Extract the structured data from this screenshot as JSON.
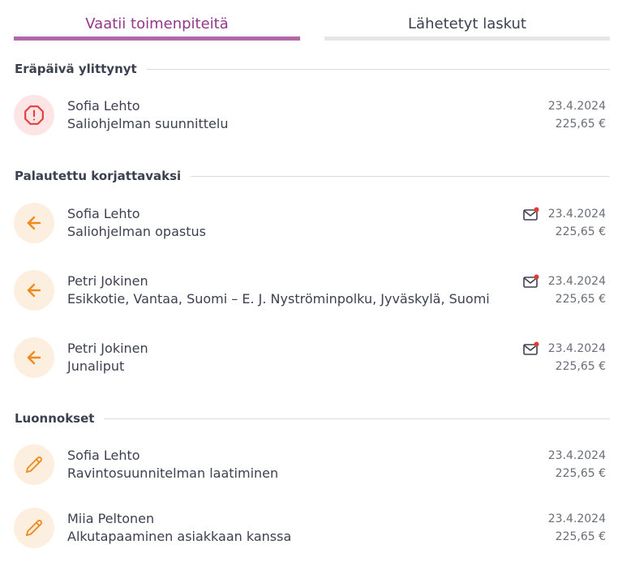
{
  "tabs": {
    "active": "Vaatii toimenpiteitä",
    "inactive": "Lähetetyt laskut"
  },
  "colors": {
    "accent": "#94378b",
    "overdue": "#e2403d",
    "returned": "#f08a1c",
    "unread_dot": "#e53935"
  },
  "sections": [
    {
      "title": "Eräpäivä ylittynyt",
      "items": [
        {
          "name": "Sofia Lehto",
          "desc": "Saliohjelman suunnittelu",
          "date": "23.4.2024",
          "amount": "225,65 €",
          "icon": "alert-octagon-icon",
          "unread_message": false
        }
      ]
    },
    {
      "title": "Palautettu korjattavaksi",
      "items": [
        {
          "name": "Sofia Lehto",
          "desc": "Saliohjelman opastus",
          "date": "23.4.2024",
          "amount": "225,65 €",
          "icon": "arrow-left-icon",
          "unread_message": true
        },
        {
          "name": "Petri Jokinen",
          "desc": "Esikkotie, Vantaa, Suomi – E. J. Nyströminpolku, Jyväskylä, Suomi",
          "date": "23.4.2024",
          "amount": "225,65 €",
          "icon": "arrow-left-icon",
          "unread_message": true
        },
        {
          "name": "Petri Jokinen",
          "desc": "Junaliput",
          "date": "23.4.2024",
          "amount": "225,65 €",
          "icon": "arrow-left-icon",
          "unread_message": true
        }
      ]
    },
    {
      "title": "Luonnokset",
      "items": [
        {
          "name": "Sofia Lehto",
          "desc": "Ravintosuunnitelman laatiminen",
          "date": "23.4.2024",
          "amount": "225,65 €",
          "icon": "pencil-icon",
          "unread_message": false
        },
        {
          "name": "Miia Peltonen",
          "desc": "Alkutapaaminen asiakkaan kanssa",
          "date": "23.4.2024",
          "amount": "225,65 €",
          "icon": "pencil-icon",
          "unread_message": false
        }
      ]
    }
  ]
}
